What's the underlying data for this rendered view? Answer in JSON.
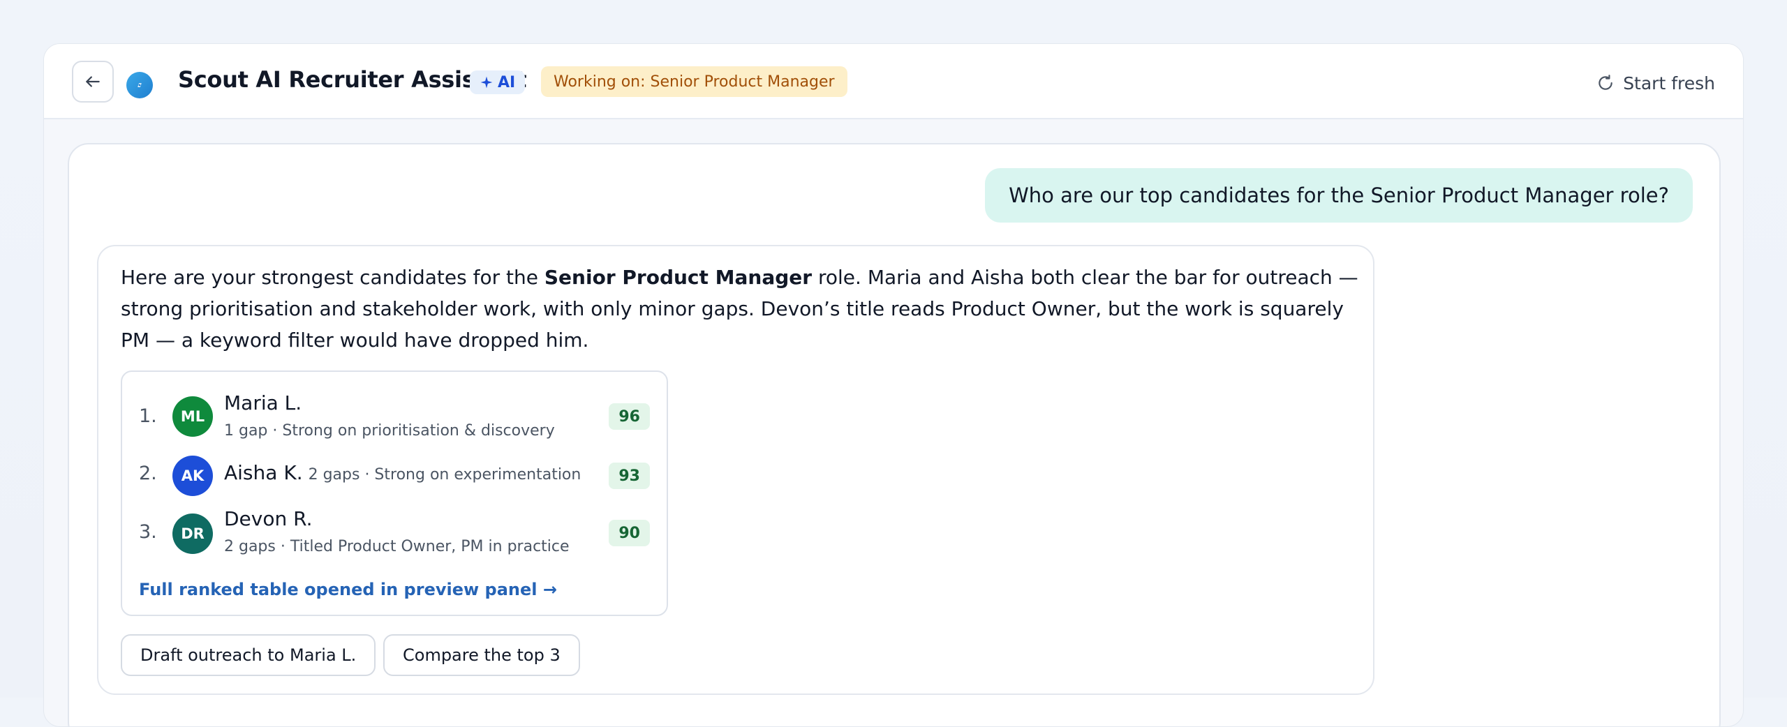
{
  "header": {
    "title": "Scout AI Recruiter Assistant",
    "ai_badge": "AI",
    "working_badge": "Working on: Senior Product Manager",
    "start_fresh": "Start fresh"
  },
  "conversation": {
    "user_message": "Who are our top candidates for the Senior Product Manager role?",
    "assistant": {
      "intro_prefix": "Here are your strongest candidates for the ",
      "intro_bold": "Senior Product Manager",
      "intro_suffix": " role. Maria and Aisha both clear the bar for outreach — strong prioritisation and stakeholder work, with only minor gaps. Devon’s title reads Product Owner, but the work is squarely PM — a keyword filter would have dropped him.",
      "candidates": [
        {
          "rank": "1.",
          "initials": "ML",
          "name": "Maria L.",
          "detail": "1 gap · Strong on prioritisation & discovery",
          "score": "96",
          "avatar_color": "#0f8a3c"
        },
        {
          "rank": "2.",
          "initials": "AK",
          "name": "Aisha K.",
          "detail": "2 gaps · Strong on experimentation",
          "score": "93",
          "avatar_color": "#1d4ed8"
        },
        {
          "rank": "3.",
          "initials": "DR",
          "name": "Devon R.",
          "detail": "2 gaps · Titled Product Owner, PM in practice",
          "score": "90",
          "avatar_color": "#0f6b62"
        }
      ],
      "table_link": "Full ranked table opened in preview panel →",
      "actions": [
        "Draft outreach to Maria L.",
        "Compare the top 3"
      ]
    }
  },
  "colors": {
    "accent": "#2563b5",
    "user_bubble": "#d9f5f0",
    "working_badge_bg": "#fdefc9",
    "score_bg": "#e3f5e9"
  }
}
